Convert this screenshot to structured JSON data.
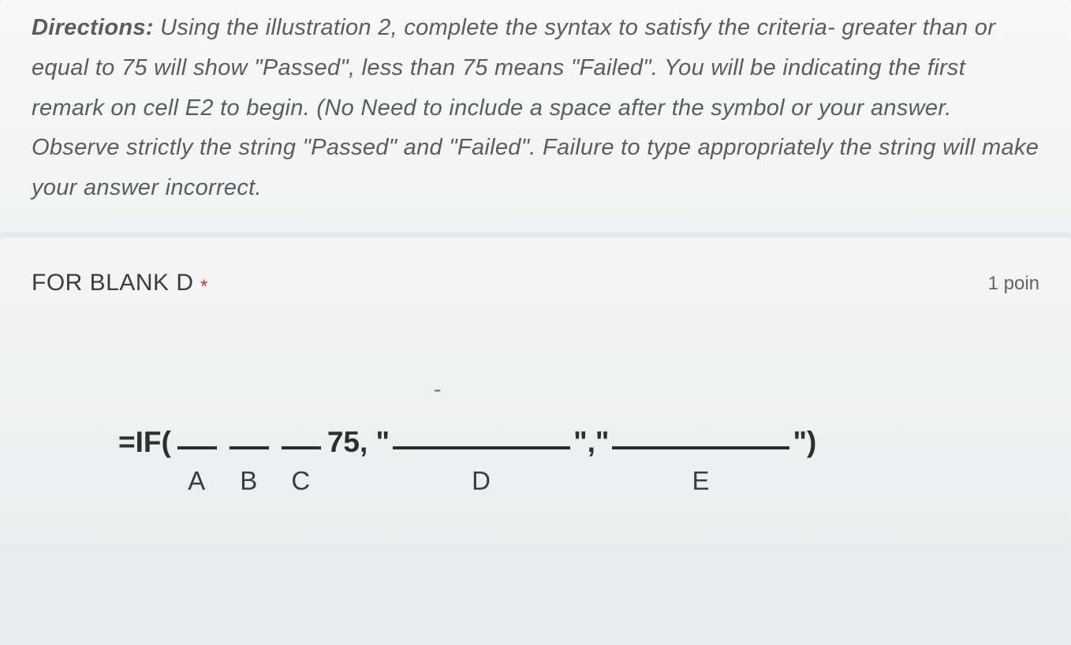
{
  "directions": {
    "label": "Directions:",
    "text": " Using the illustration 2, complete the syntax to satisfy the criteria- greater than or",
    "text2": "equal to 75 will show \"Passed\", less than 75 means \"Failed\". You will be indicating the first remark on cell E2 to begin. (No Need to include a space after the symbol or your answer. Observe strictly the string \"Passed\" and \"Failed\". Failure to type appropriately the string will make your answer incorrect."
  },
  "question": {
    "title": "FOR BLANK D",
    "required": "*",
    "points": "1 poin"
  },
  "formula": {
    "prefix": "=IF(",
    "mid1": " 75, \"",
    "mid2": "\",\"",
    "suffix": "\")",
    "dash": "-",
    "blanks": {
      "a": "A",
      "b": "B",
      "c": "C",
      "d": "D",
      "e": "E"
    }
  }
}
